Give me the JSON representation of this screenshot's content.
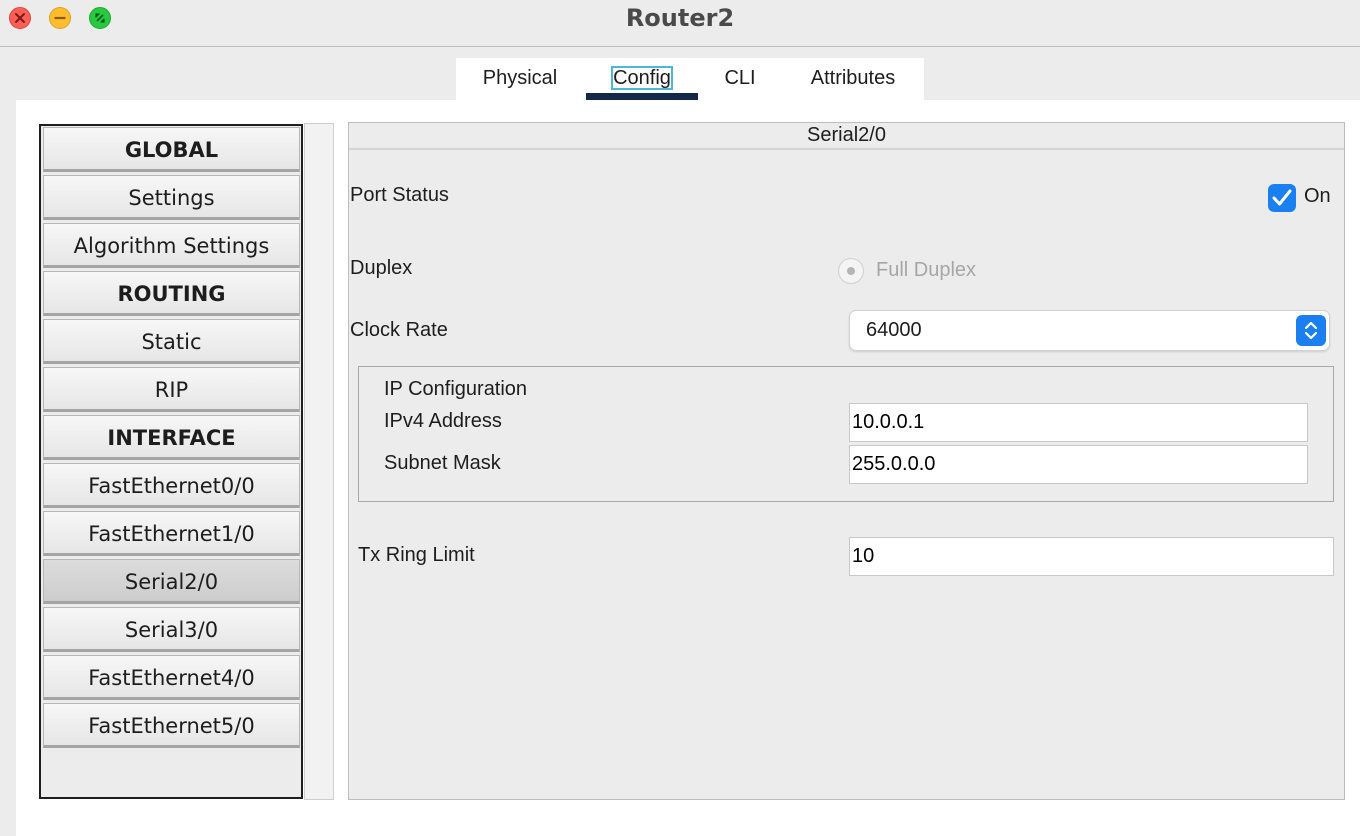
{
  "window": {
    "title": "Router2"
  },
  "tabs": [
    {
      "label": "Physical"
    },
    {
      "label": "Config"
    },
    {
      "label": "CLI"
    },
    {
      "label": "Attributes"
    }
  ],
  "sidebar": {
    "items": [
      {
        "label": "GLOBAL",
        "type": "header"
      },
      {
        "label": "Settings",
        "type": "item"
      },
      {
        "label": "Algorithm Settings",
        "type": "item"
      },
      {
        "label": "ROUTING",
        "type": "header"
      },
      {
        "label": "Static",
        "type": "item"
      },
      {
        "label": "RIP",
        "type": "item"
      },
      {
        "label": "INTERFACE",
        "type": "header"
      },
      {
        "label": "FastEthernet0/0",
        "type": "item"
      },
      {
        "label": "FastEthernet1/0",
        "type": "item"
      },
      {
        "label": "Serial2/0",
        "type": "item",
        "selected": true
      },
      {
        "label": "Serial3/0",
        "type": "item"
      },
      {
        "label": "FastEthernet4/0",
        "type": "item"
      },
      {
        "label": "FastEthernet5/0",
        "type": "item"
      }
    ]
  },
  "panel": {
    "title": "Serial2/0",
    "port_status": {
      "label": "Port Status",
      "checkbox_label": "On",
      "checked": true
    },
    "duplex": {
      "label": "Duplex",
      "option_label": "Full Duplex",
      "disabled": true
    },
    "clock_rate": {
      "label": "Clock Rate",
      "value": "64000"
    },
    "ip_config": {
      "title": "IP Configuration",
      "ipv4_label": "IPv4 Address",
      "ipv4_value": "10.0.0.1",
      "subnet_label": "Subnet Mask",
      "subnet_value": "255.0.0.0"
    },
    "tx_ring": {
      "label": "Tx Ring Limit",
      "value": "10"
    }
  },
  "colors": {
    "accent": "#1a7ff0",
    "tab_indicator": "#14294a",
    "disabled_text": "#a6a6a6"
  }
}
